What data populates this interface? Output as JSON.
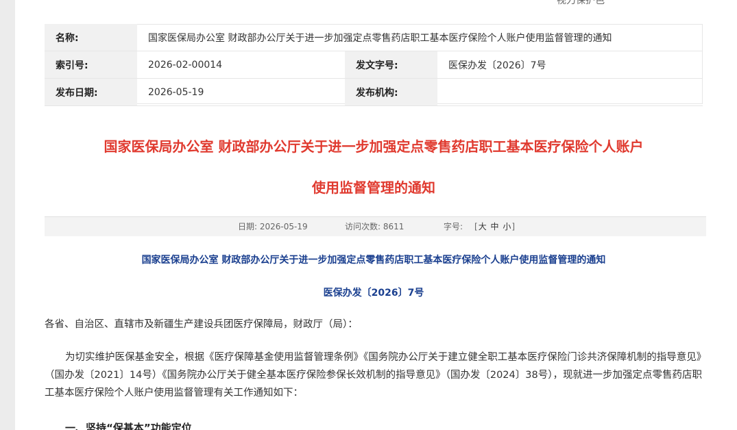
{
  "top_partial": "视力保护色",
  "meta": {
    "name_label": "名称:",
    "name_value": "国家医保局办公室 财政部办公厅关于进一步加强定点零售药店职工基本医疗保险个人账户使用监督管理的通知",
    "index_label": "索引号:",
    "index_value": "2026-02-00014",
    "docno_label": "发文字号:",
    "docno_value": "医保办发〔2026〕7号",
    "date_label": "发布日期:",
    "date_value": "2026-05-19",
    "org_label": "发布机构:",
    "org_value": ""
  },
  "title_line1": "国家医保局办公室 财政部办公厅关于进一步加强定点零售药店职工基本医疗保险个人账户",
  "title_line2": "使用监督管理的通知",
  "infobar": {
    "date": "日期: 2026-05-19",
    "visits": "访问次数: 8611",
    "font_label": "字号:",
    "open": "[",
    "large": "大",
    "medium": "中",
    "small": "小",
    "close": "]"
  },
  "doc_heading": "国家医保局办公室 财政部办公厅关于进一步加强定点零售药店职工基本医疗保险个人账户使用监督管理的通知",
  "doc_number": "医保办发〔2026〕7号",
  "addressee": "各省、自治区、直辖市及新疆生产建设兵团医疗保障局，财政厅（局）：",
  "paragraph": "为切实维护医保基金安全，根据《医疗保障基金使用监督管理条例》《国务院办公厅关于建立健全职工基本医疗保险门诊共济保障机制的指导意见》（国办发〔2021〕14号）《国务院办公厅关于健全基本医疗保险参保长效机制的指导意见》（国办发〔2024〕38号），现就进一步加强定点零售药店职工基本医疗保险个人账户使用监督管理有关工作通知如下：",
  "section_heading": "一、坚持“保基本”功能定位"
}
